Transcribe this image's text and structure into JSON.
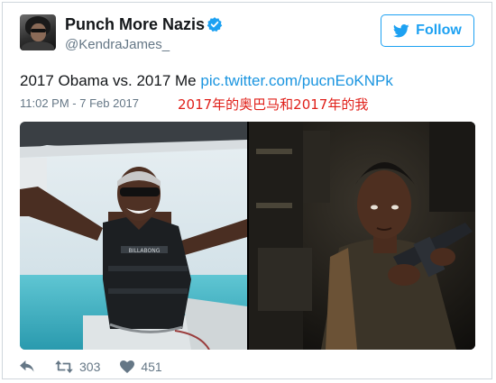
{
  "user": {
    "display_name": "Punch More Nazis",
    "handle": "@KendraJames_",
    "avatar_icon": "avatar",
    "verified_icon": "verified-badge-icon"
  },
  "follow_button": {
    "label": "Follow",
    "icon": "twitter-bird-icon",
    "color": "#1da1f2"
  },
  "tweet": {
    "text": "2017 Obama vs. 2017 Me",
    "link": "pic.twitter.com/pucnEoKNPk",
    "timestamp": "11:02 PM - 7 Feb 2017",
    "annotation": "2017年的奥巴马和2017年的我",
    "annotation_color": "#e0201a"
  },
  "media": {
    "left_image": {
      "vest_text": "BILLABONG"
    },
    "right_image": {}
  },
  "actions": {
    "reply_icon": "reply-icon",
    "retweet_icon": "retweet-icon",
    "retweet_count": "303",
    "like_icon": "heart-icon",
    "like_count": "451"
  }
}
